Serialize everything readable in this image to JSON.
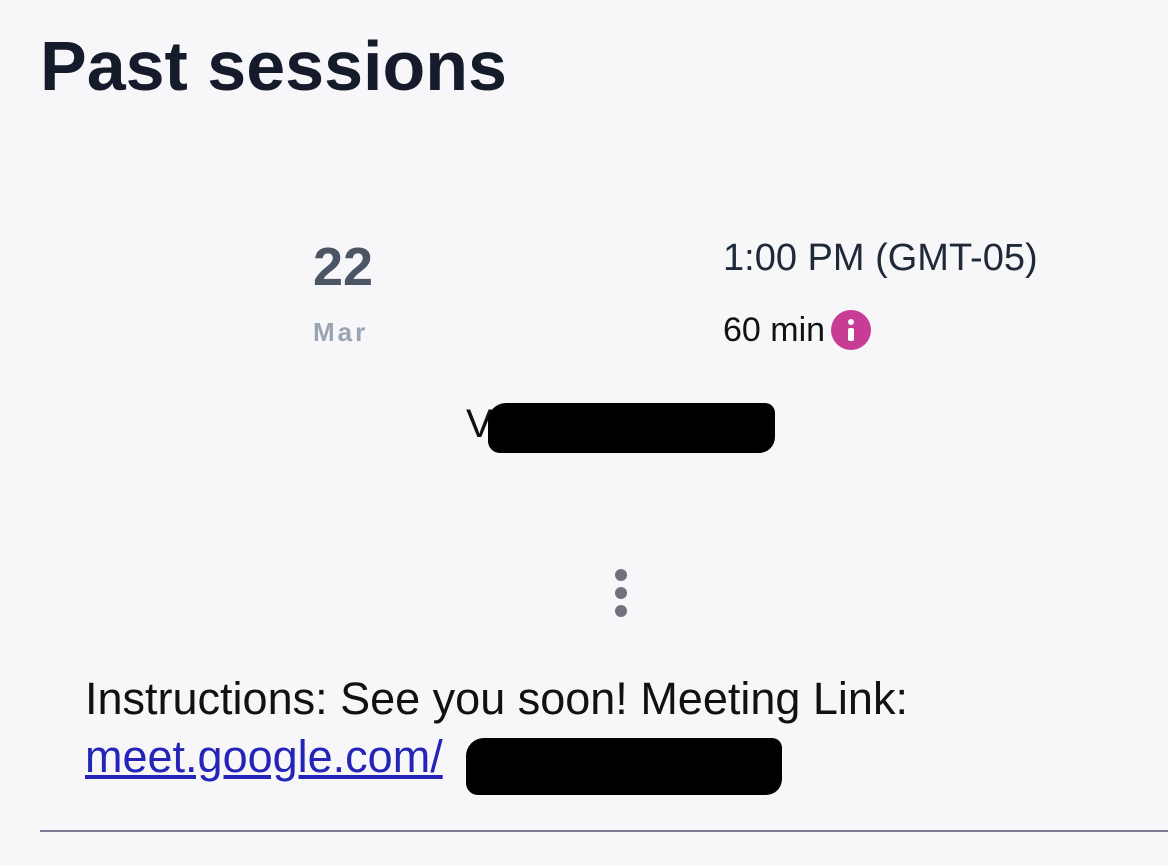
{
  "page": {
    "title": "Past sessions"
  },
  "session": {
    "date": {
      "day": "22",
      "month": "Mar"
    },
    "time": "1:00 PM (GMT-05)",
    "duration": "60 min",
    "attendee": "V",
    "instructions": "Instructions: See you soon! Meeting Link:",
    "meeting_link": "meet.google.com/"
  },
  "icons": {
    "duration_info": "info-icon",
    "menu": "more-vertical-icon"
  },
  "colors": {
    "background": "#f7f7fa",
    "title": "#161b2c",
    "accent": "#c73c95",
    "link": "#2424b8",
    "divider": "#787b92"
  }
}
